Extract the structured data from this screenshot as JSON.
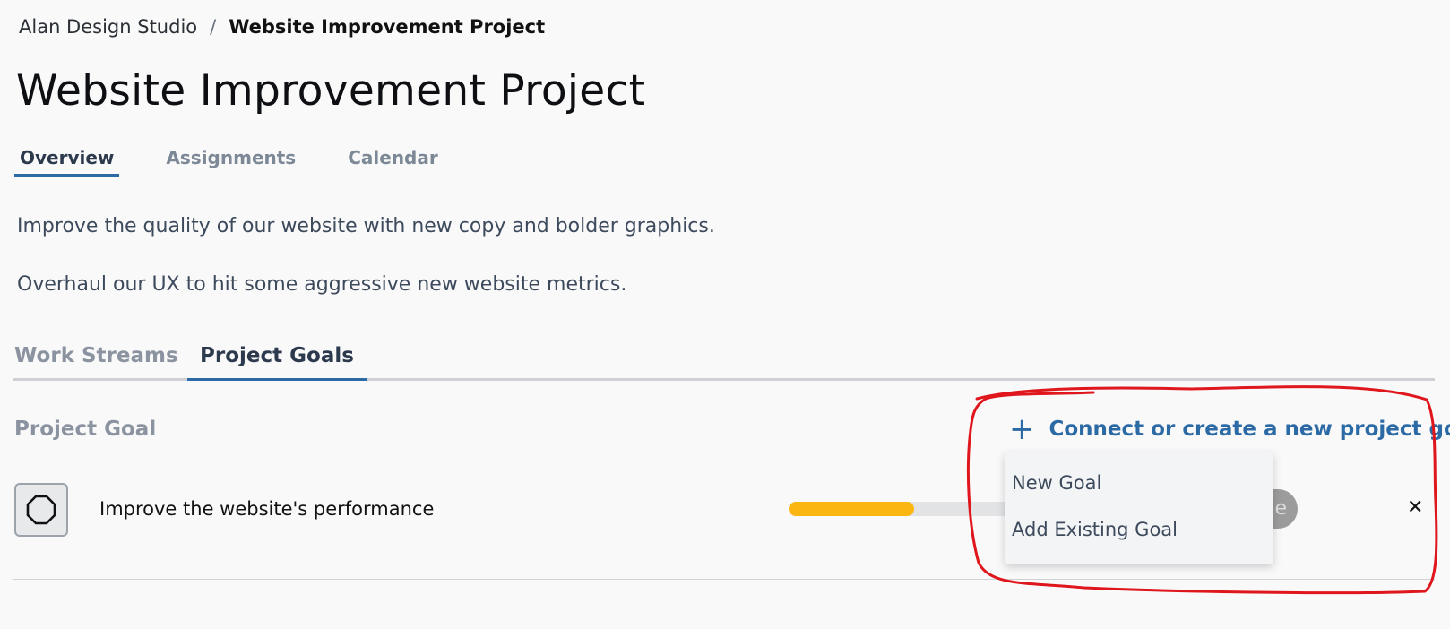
{
  "breadcrumb": {
    "org": "Alan Design Studio",
    "separator": "/",
    "current": "Website Improvement Project"
  },
  "page_title": "Website Improvement Project",
  "top_tabs": [
    {
      "label": "Overview",
      "active": true
    },
    {
      "label": "Assignments",
      "active": false
    },
    {
      "label": "Calendar",
      "active": false
    }
  ],
  "description": [
    "Improve the quality of our website with new copy and bolder graphics.",
    "Overhaul our UX to hit some aggressive new website metrics."
  ],
  "sub_tabs": [
    {
      "label": "Work Streams",
      "active": false
    },
    {
      "label": "Project Goals",
      "active": true
    }
  ],
  "goals_section": {
    "header": "Project Goal",
    "connect_label": "Connect or create a new project goal",
    "connect_icon": "plus-icon",
    "goals": [
      {
        "name": "Improve the website's performance",
        "icon": "octagon-icon",
        "progress": 0.5,
        "status_text": "e"
      }
    ]
  },
  "dropdown": {
    "items": [
      "New Goal",
      "Add Existing Goal"
    ]
  },
  "colors": {
    "accent": "#2b6aa5",
    "progress": "#fbb611",
    "annotation": "#e0161d"
  }
}
